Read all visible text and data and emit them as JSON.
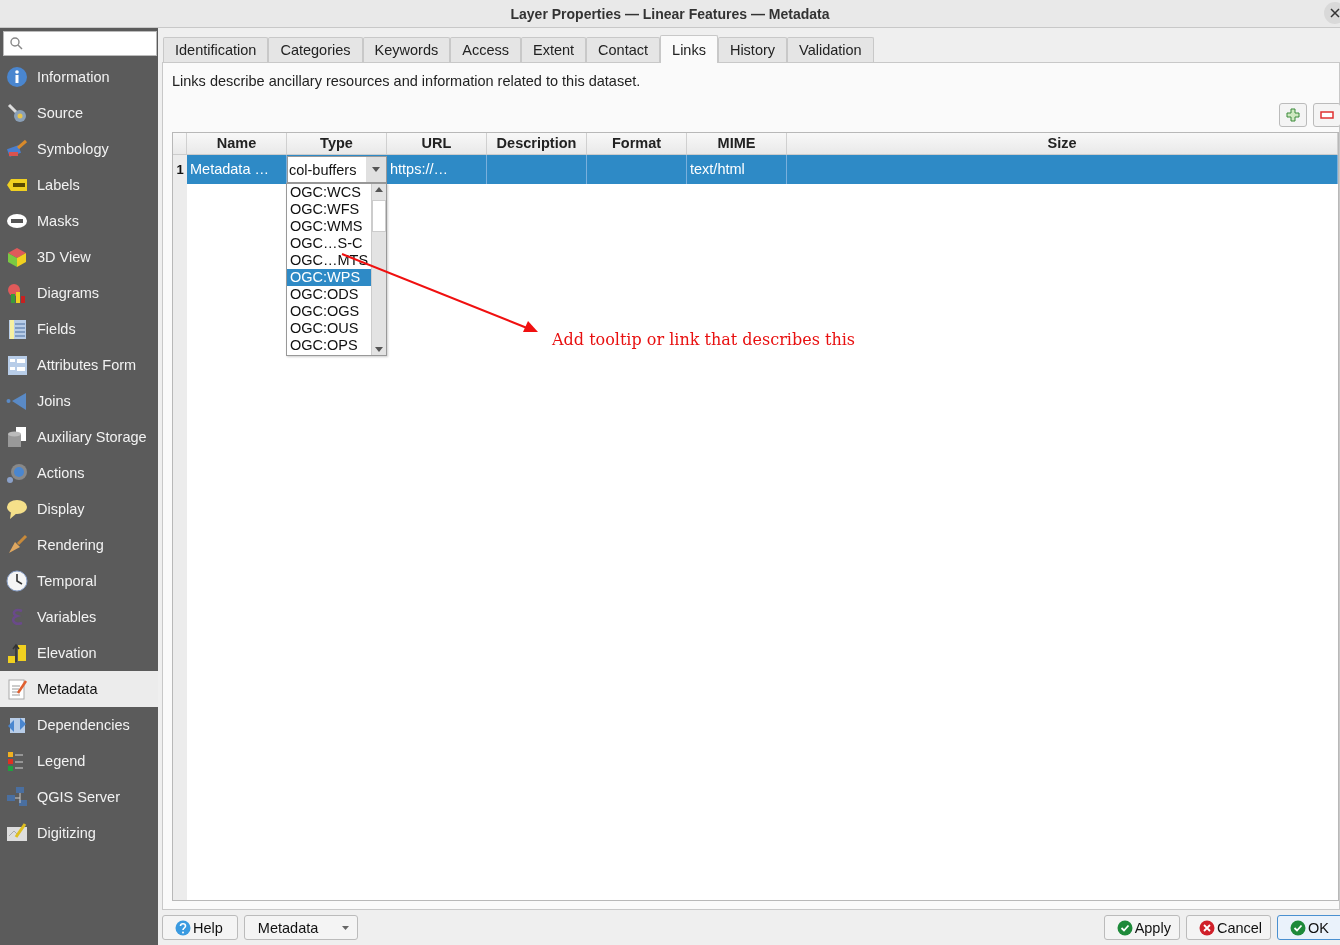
{
  "window": {
    "title": "Layer Properties — Linear Features — Metadata"
  },
  "sidebar": {
    "items": [
      {
        "label": "Information",
        "selected": false
      },
      {
        "label": "Source",
        "selected": false
      },
      {
        "label": "Symbology",
        "selected": false
      },
      {
        "label": "Labels",
        "selected": false
      },
      {
        "label": "Masks",
        "selected": false
      },
      {
        "label": "3D View",
        "selected": false
      },
      {
        "label": "Diagrams",
        "selected": false
      },
      {
        "label": "Fields",
        "selected": false
      },
      {
        "label": "Attributes Form",
        "selected": false
      },
      {
        "label": "Joins",
        "selected": false
      },
      {
        "label": "Auxiliary Storage",
        "selected": false
      },
      {
        "label": "Actions",
        "selected": false
      },
      {
        "label": "Display",
        "selected": false
      },
      {
        "label": "Rendering",
        "selected": false
      },
      {
        "label": "Temporal",
        "selected": false
      },
      {
        "label": "Variables",
        "selected": false
      },
      {
        "label": "Elevation",
        "selected": false
      },
      {
        "label": "Metadata",
        "selected": true
      },
      {
        "label": "Dependencies",
        "selected": false
      },
      {
        "label": "Legend",
        "selected": false
      },
      {
        "label": "QGIS Server",
        "selected": false
      },
      {
        "label": "Digitizing",
        "selected": false
      }
    ]
  },
  "tabs": [
    {
      "label": "Identification",
      "selected": false
    },
    {
      "label": "Categories",
      "selected": false
    },
    {
      "label": "Keywords",
      "selected": false
    },
    {
      "label": "Access",
      "selected": false
    },
    {
      "label": "Extent",
      "selected": false
    },
    {
      "label": "Contact",
      "selected": false
    },
    {
      "label": "Links",
      "selected": true
    },
    {
      "label": "History",
      "selected": false
    },
    {
      "label": "Validation",
      "selected": false
    }
  ],
  "description": "Links describe ancillary resources and information related to this dataset.",
  "table": {
    "columns": [
      "Name",
      "Type",
      "URL",
      "Description",
      "Format",
      "MIME",
      "Size"
    ],
    "rows": [
      {
        "number": "1",
        "selected": true,
        "cells": [
          "Metadata …",
          "col-buffers",
          "https://…",
          "",
          "",
          "text/html",
          ""
        ]
      }
    ]
  },
  "type_dropdown": {
    "options": [
      {
        "label": "OGC:WCS",
        "selected": false
      },
      {
        "label": "OGC:WFS",
        "selected": false
      },
      {
        "label": "OGC:WMS",
        "selected": false
      },
      {
        "label": "OGC…S-C",
        "selected": false
      },
      {
        "label": "OGC…MTS",
        "selected": false
      },
      {
        "label": "OGC:WPS",
        "selected": true
      },
      {
        "label": "OGC:ODS",
        "selected": false
      },
      {
        "label": "OGC:OGS",
        "selected": false
      },
      {
        "label": "OGC:OUS",
        "selected": false
      },
      {
        "label": "OGC:OPS",
        "selected": false
      }
    ]
  },
  "annotation": {
    "text": "Add tooltip or link that describes this"
  },
  "footer": {
    "left": [
      {
        "label": "Help",
        "kind": "help",
        "default": false
      },
      {
        "label": "Metadata",
        "kind": "menu",
        "default": false
      }
    ],
    "right": [
      {
        "label": "Apply",
        "kind": "apply",
        "default": false
      },
      {
        "label": "Cancel",
        "kind": "cancel",
        "default": false
      },
      {
        "label": "OK",
        "kind": "ok",
        "default": true
      }
    ]
  }
}
